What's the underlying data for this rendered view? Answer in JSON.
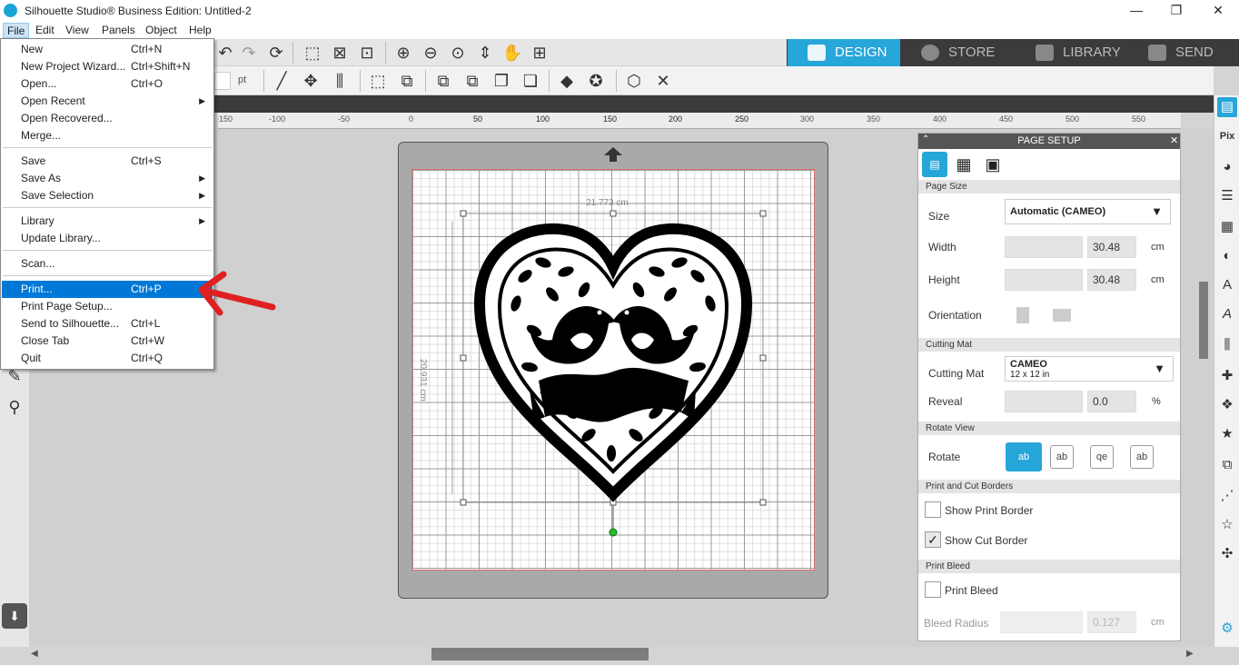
{
  "window": {
    "title": "Silhouette Studio® Business Edition: Untitled-2"
  },
  "menubar": [
    "File",
    "Edit",
    "View",
    "Panels",
    "Object",
    "Help"
  ],
  "toolbar": {
    "unit_label": "pt"
  },
  "nav_tabs": [
    {
      "label": "DESIGN",
      "active": true
    },
    {
      "label": "STORE",
      "active": false
    },
    {
      "label": "LIBRARY",
      "active": false
    },
    {
      "label": "SEND",
      "active": false
    }
  ],
  "ruler": {
    "ticks": [
      "-150",
      "-100",
      "-50",
      "0",
      "50",
      "100",
      "150",
      "200",
      "250",
      "300",
      "350",
      "400",
      "450",
      "500",
      "550"
    ]
  },
  "canvas": {
    "width_dimension": "21.773 cm",
    "height_dimension": "20.931 cm"
  },
  "file_menu": {
    "items": [
      {
        "label": "New",
        "shortcut": "Ctrl+N"
      },
      {
        "label": "New Project Wizard...",
        "shortcut": "Ctrl+Shift+N"
      },
      {
        "label": "Open...",
        "shortcut": "Ctrl+O"
      },
      {
        "label": "Open Recent",
        "submenu": true
      },
      {
        "label": "Open Recovered...",
        "shortcut": ""
      },
      {
        "label": "Merge...",
        "shortcut": ""
      },
      {
        "label": "Save",
        "shortcut": "Ctrl+S"
      },
      {
        "label": "Save As",
        "submenu": true
      },
      {
        "label": "Save Selection",
        "submenu": true
      },
      {
        "label": "Library",
        "submenu": true
      },
      {
        "label": "Update Library...",
        "shortcut": ""
      },
      {
        "label": "Scan...",
        "shortcut": ""
      },
      {
        "label": "Print...",
        "shortcut": "Ctrl+P",
        "highlighted": true
      },
      {
        "label": "Print Page Setup...",
        "shortcut": ""
      },
      {
        "label": "Send to Silhouette...",
        "shortcut": "Ctrl+L"
      },
      {
        "label": "Close Tab",
        "shortcut": "Ctrl+W"
      },
      {
        "label": "Quit",
        "shortcut": "Ctrl+Q"
      }
    ]
  },
  "page_setup": {
    "title": "PAGE SETUP",
    "sections": {
      "page_size": "Page Size",
      "cutting_mat": "Cutting Mat",
      "rotate_view": "Rotate View",
      "print_cut_borders": "Print and Cut Borders",
      "print_bleed": "Print Bleed"
    },
    "size_label": "Size",
    "size_value": "Automatic (CAMEO)",
    "width_label": "Width",
    "width_value": "30.48",
    "height_label": "Height",
    "height_value": "30.48",
    "unit_cm": "cm",
    "orientation_label": "Orientation",
    "cutting_mat_label": "Cutting Mat",
    "cutting_mat_value": "CAMEO",
    "cutting_mat_sub": "12 x 12 in",
    "reveal_label": "Reveal",
    "reveal_value": "0.0",
    "unit_percent": "%",
    "rotate_label": "Rotate",
    "rotate_options": [
      "ab",
      "ab",
      "qe",
      "ab"
    ],
    "show_print_border": {
      "label": "Show Print Border",
      "checked": false
    },
    "show_cut_border": {
      "label": "Show Cut Border",
      "checked": true
    },
    "print_bleed": {
      "label": "Print Bleed",
      "checked": false
    },
    "bleed_radius_label": "Bleed Radius",
    "bleed_radius_value": "0.127"
  },
  "colors": {
    "accent": "#27a6d9",
    "menu_highlight": "#0078d7",
    "annotation_arrow": "#e02020"
  }
}
